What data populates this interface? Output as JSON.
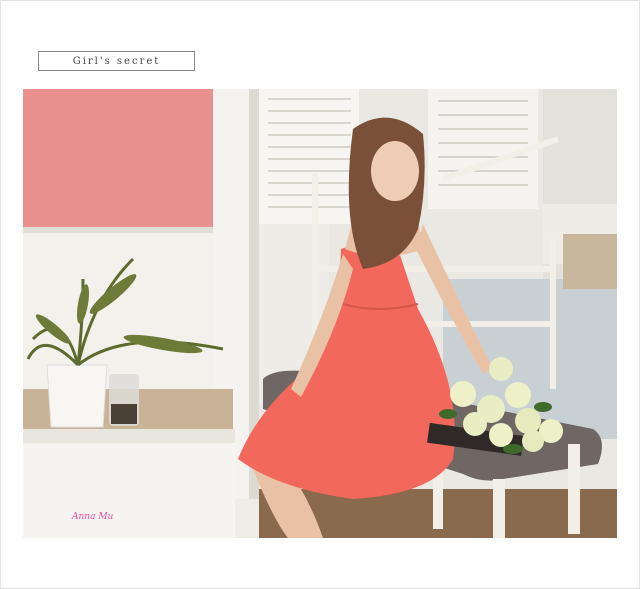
{
  "section_label": "Girl's secret",
  "photo": {
    "description_icon": "photo-scene",
    "colors": {
      "wall_pink": "#e8918f",
      "dress_coral": "#f2685c",
      "bench_gray": "#6f6763",
      "bed_frame": "#f1efe8",
      "floor_wood": "#8a6a4d"
    }
  },
  "watermark": {
    "text": "Anna Mu"
  }
}
